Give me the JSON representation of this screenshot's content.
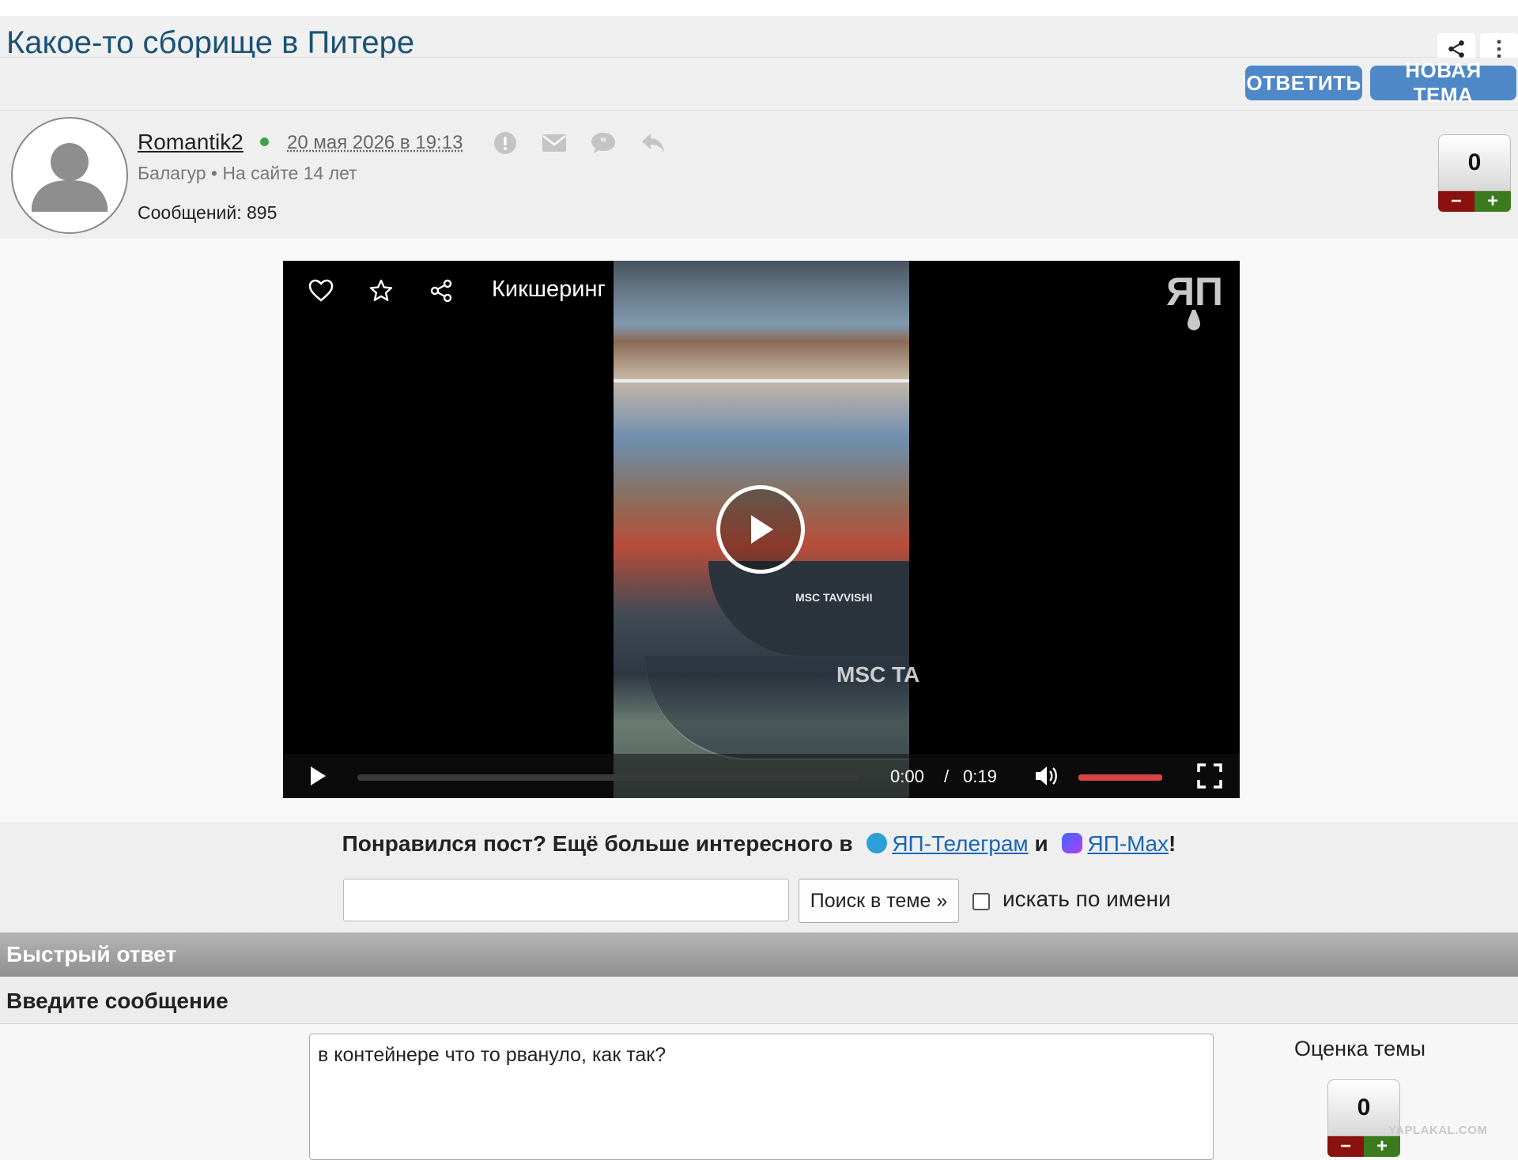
{
  "topic": {
    "title": "Какое-то сборище в Питере"
  },
  "toolbar": {
    "reply_label": "ОТВЕТИТЬ",
    "new_topic_label": "НОВАЯ ТЕМА"
  },
  "post": {
    "author": "Romantik2",
    "date": "20 мая 2026 в 19:13",
    "user_meta": "Балагур  •  На сайте 14 лет",
    "post_count": "Сообщений: 895",
    "rating": "0",
    "minus": "−",
    "plus": "+"
  },
  "video": {
    "title": "Кикшеринг",
    "logo": "ЯП",
    "current_time": "0:00",
    "separator": "/",
    "duration": "0:19",
    "progress": 0,
    "volume": 1.0,
    "ship_label_small": "MSC TAVVISHI",
    "ship_label_large": "MSC TA"
  },
  "promo": {
    "text_before": "Понравился пост? Ещё больше интересного в",
    "telegram_link": "ЯП-Телеграм",
    "and": "и",
    "max_link": "ЯП-Max",
    "exclaim": "!"
  },
  "search": {
    "input_value": "",
    "button_label": "Поиск в теме »",
    "checkbox_label": "искать по имени",
    "checkbox_checked": false
  },
  "quick_reply": {
    "title": "Быстрый ответ",
    "enter_label": "Введите сообщение",
    "message": "в контейнере что то рвануло, как так?",
    "topic_rating_label": "Оценка темы",
    "topic_rating": "0",
    "minus": "−",
    "plus": "+"
  },
  "watermark": "YAPLAKAL.COM",
  "colors": {
    "title": "#1a5276",
    "button_blue": "#4f88c8",
    "link": "#1a66b5",
    "online": "#3fa34d",
    "rating_minus": "#8b1010",
    "rating_plus": "#3b7a1e",
    "volume": "#d64545"
  }
}
